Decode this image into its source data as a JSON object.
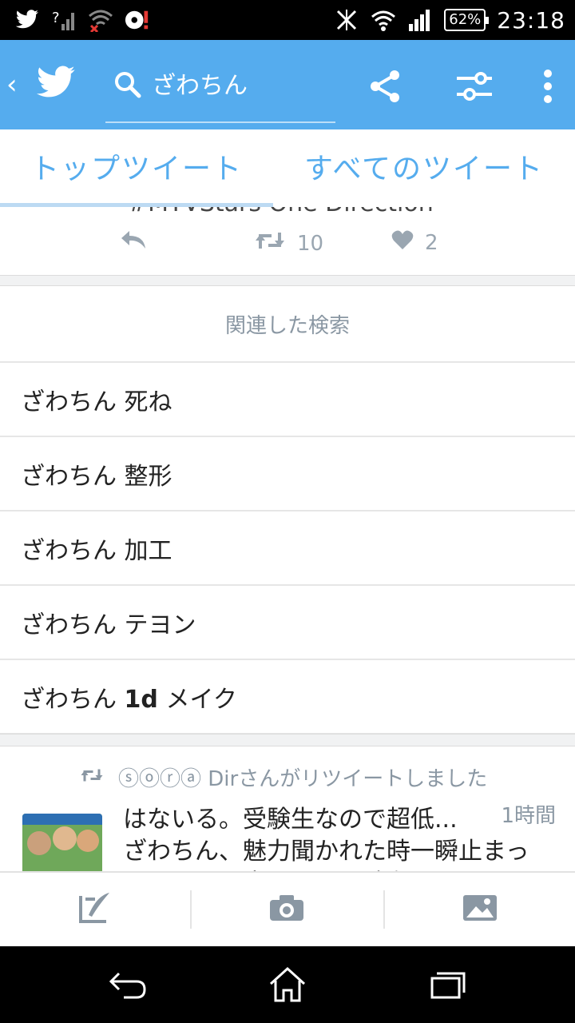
{
  "status_bar": {
    "battery": "62%",
    "time": "23:18",
    "left_icons": [
      "twitter-bird-icon",
      "no-sim-signal-icon",
      "wifi-off-icon",
      "record-alert-icon"
    ],
    "right_icons": [
      "nfc-icon",
      "wifi-icon",
      "signal-icon",
      "battery-icon"
    ]
  },
  "toolbar": {
    "search_query": "ざわちん",
    "background_color": "#55acee",
    "icons": [
      "back-icon",
      "twitter-logo-icon",
      "search-icon",
      "share-icon",
      "filter-icon",
      "overflow-menu-icon"
    ]
  },
  "tabs": [
    {
      "label": "トップツイート",
      "active": true
    },
    {
      "label": "すべてのツイート",
      "active": false
    }
  ],
  "partial_tweet": {
    "text": "#MTVStars One Direction",
    "retweets": "10",
    "likes": "2"
  },
  "related": {
    "header": "関連した検索",
    "items": [
      {
        "prefix": "ざわちん",
        "suffix": "死ね"
      },
      {
        "prefix": "ざわちん",
        "suffix": "整形"
      },
      {
        "prefix": "ざわちん",
        "suffix": "加工"
      },
      {
        "prefix": "ざわちん",
        "suffix": "テヨン"
      },
      {
        "prefix": "ざわちん",
        "suffix": "1d メイク",
        "bold_part": "1d"
      }
    ]
  },
  "tweet": {
    "retweeted_by": "ⓢⓞⓡⓐ Dirさんがリツイートしました",
    "line1": "はないる。受験生なので超低...",
    "time": "1時間",
    "line2": "ざわちん、魅力聞かれた時一瞬止まっ",
    "line3": "てちん日げ声ほ　てち時有　たよっう"
  },
  "compose_bar": {
    "icons": [
      "compose-tweet-icon",
      "camera-icon",
      "gallery-icon"
    ]
  },
  "nav_bar": {
    "icons": [
      "back-nav-icon",
      "home-nav-icon",
      "recents-nav-icon"
    ]
  }
}
